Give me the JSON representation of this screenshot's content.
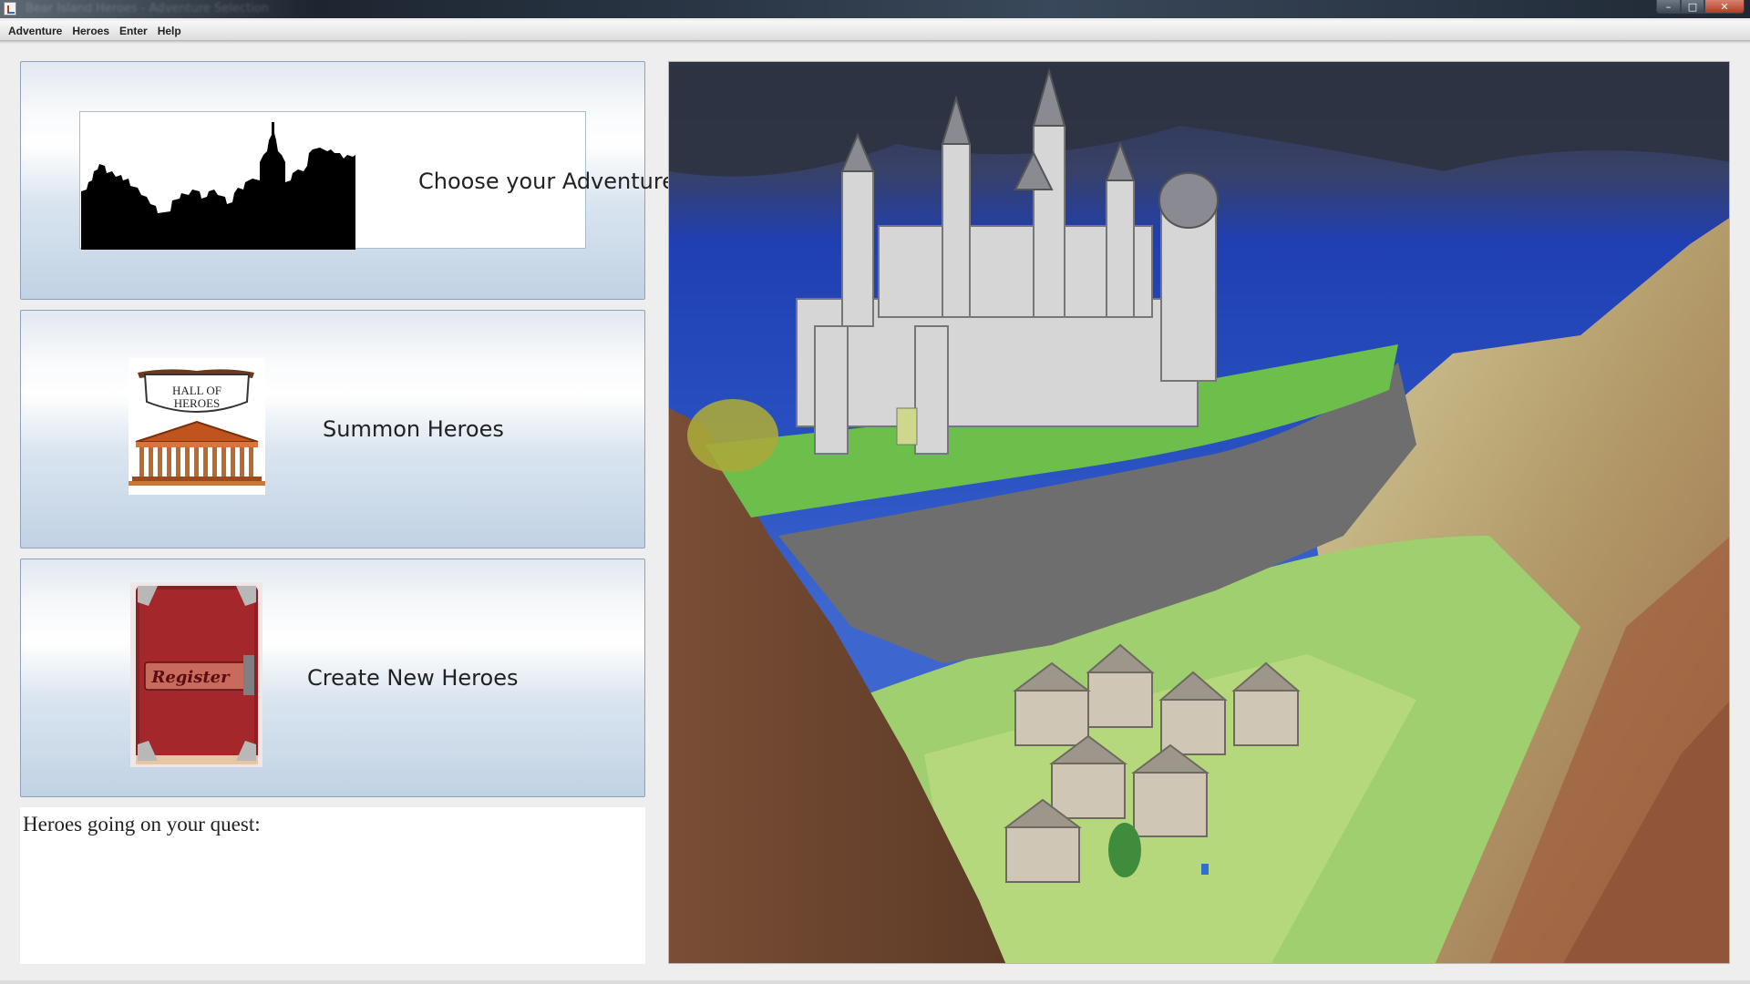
{
  "window": {
    "title": "Bear Island Heroes - Adventure Selection",
    "controls": {
      "minimize": "–",
      "maximize": "□",
      "close": "✕"
    }
  },
  "menu": [
    "Adventure",
    "Heroes",
    "Enter",
    "Help"
  ],
  "buttons": {
    "adventure": "Choose your Adventure",
    "summon": "Summon Heroes",
    "create": "Create New Heroes"
  },
  "images": {
    "summon_sign": [
      "HALL OF",
      "HEROES"
    ],
    "register_book": "Register"
  },
  "quest": {
    "label": "Heroes going on your quest:"
  },
  "icons": {
    "app": "java-icon",
    "adventure": "city-skyline-icon",
    "summon": "hall-of-heroes-icon",
    "create": "register-book-icon",
    "painting": "castle-painting-image"
  }
}
